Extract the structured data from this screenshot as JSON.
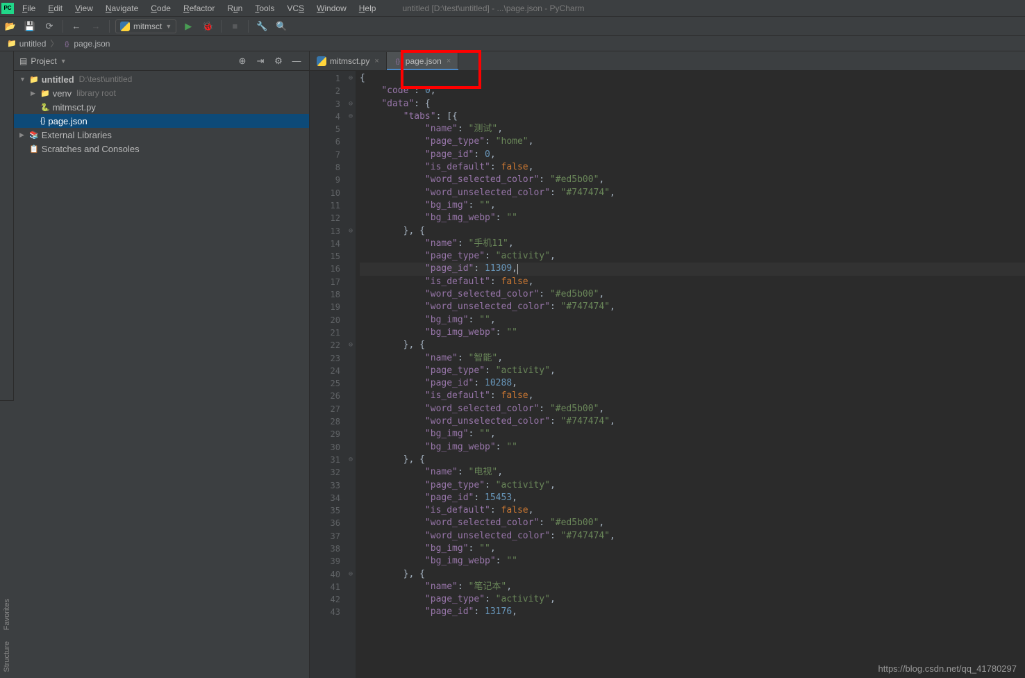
{
  "titlebar": {
    "title": "untitled [D:\\test\\untitled] - ...\\page.json - PyCharm"
  },
  "menu": [
    {
      "label": "File",
      "u": 0
    },
    {
      "label": "Edit",
      "u": 0
    },
    {
      "label": "View",
      "u": 0
    },
    {
      "label": "Navigate",
      "u": 0
    },
    {
      "label": "Code",
      "u": 0
    },
    {
      "label": "Refactor",
      "u": 0
    },
    {
      "label": "Run",
      "u": 1
    },
    {
      "label": "Tools",
      "u": 0
    },
    {
      "label": "VCS",
      "u": 2
    },
    {
      "label": "Window",
      "u": 0
    },
    {
      "label": "Help",
      "u": 0
    }
  ],
  "runconfig": {
    "name": "mitmsct"
  },
  "breadcrumbs": [
    {
      "icon": "folder",
      "text": "untitled"
    },
    {
      "icon": "json",
      "text": "page.json"
    }
  ],
  "panel": {
    "title": "Project"
  },
  "tree": [
    {
      "indent": 0,
      "arrow": "▼",
      "icon": "folder",
      "label": "untitled",
      "hint": "D:\\test\\untitled",
      "bold": true
    },
    {
      "indent": 1,
      "arrow": "▶",
      "icon": "folder",
      "label": "venv",
      "hint": "library root"
    },
    {
      "indent": 1,
      "arrow": "",
      "icon": "py",
      "label": "mitmsct.py"
    },
    {
      "indent": 1,
      "arrow": "",
      "icon": "json",
      "label": "page.json",
      "selected": true
    },
    {
      "indent": 0,
      "arrow": "▶",
      "icon": "lib",
      "label": "External Libraries"
    },
    {
      "indent": 0,
      "arrow": "",
      "icon": "scratch",
      "label": "Scratches and Consoles"
    }
  ],
  "tabs": [
    {
      "icon": "py",
      "label": "mitmsct.py",
      "active": false
    },
    {
      "icon": "json",
      "label": "page.json",
      "active": true
    }
  ],
  "code": [
    [
      {
        "t": "{",
        "c": "p"
      }
    ],
    [
      {
        "t": "    ",
        "c": "p"
      },
      {
        "t": "\"code\"",
        "c": "k"
      },
      {
        "t": ": ",
        "c": "p"
      },
      {
        "t": "0",
        "c": "n"
      },
      {
        "t": ",",
        "c": "p"
      }
    ],
    [
      {
        "t": "    ",
        "c": "p"
      },
      {
        "t": "\"data\"",
        "c": "k"
      },
      {
        "t": ": {",
        "c": "p"
      }
    ],
    [
      {
        "t": "        ",
        "c": "p"
      },
      {
        "t": "\"tabs\"",
        "c": "k"
      },
      {
        "t": ": [{",
        "c": "p"
      }
    ],
    [
      {
        "t": "            ",
        "c": "p"
      },
      {
        "t": "\"name\"",
        "c": "k"
      },
      {
        "t": ": ",
        "c": "p"
      },
      {
        "t": "\"测试\"",
        "c": "s"
      },
      {
        "t": ",",
        "c": "p"
      }
    ],
    [
      {
        "t": "            ",
        "c": "p"
      },
      {
        "t": "\"page_type\"",
        "c": "k"
      },
      {
        "t": ": ",
        "c": "p"
      },
      {
        "t": "\"home\"",
        "c": "s"
      },
      {
        "t": ",",
        "c": "p"
      }
    ],
    [
      {
        "t": "            ",
        "c": "p"
      },
      {
        "t": "\"page_id\"",
        "c": "k"
      },
      {
        "t": ": ",
        "c": "p"
      },
      {
        "t": "0",
        "c": "n"
      },
      {
        "t": ",",
        "c": "p"
      }
    ],
    [
      {
        "t": "            ",
        "c": "p"
      },
      {
        "t": "\"is_default\"",
        "c": "k"
      },
      {
        "t": ": ",
        "c": "p"
      },
      {
        "t": "false",
        "c": "b"
      },
      {
        "t": ",",
        "c": "p"
      }
    ],
    [
      {
        "t": "            ",
        "c": "p"
      },
      {
        "t": "\"word_selected_color\"",
        "c": "k"
      },
      {
        "t": ": ",
        "c": "p"
      },
      {
        "t": "\"#ed5b00\"",
        "c": "s"
      },
      {
        "t": ",",
        "c": "p"
      }
    ],
    [
      {
        "t": "            ",
        "c": "p"
      },
      {
        "t": "\"word_unselected_color\"",
        "c": "k"
      },
      {
        "t": ": ",
        "c": "p"
      },
      {
        "t": "\"#747474\"",
        "c": "s"
      },
      {
        "t": ",",
        "c": "p"
      }
    ],
    [
      {
        "t": "            ",
        "c": "p"
      },
      {
        "t": "\"bg_img\"",
        "c": "k"
      },
      {
        "t": ": ",
        "c": "p"
      },
      {
        "t": "\"\"",
        "c": "s"
      },
      {
        "t": ",",
        "c": "p"
      }
    ],
    [
      {
        "t": "            ",
        "c": "p"
      },
      {
        "t": "\"bg_img_webp\"",
        "c": "k"
      },
      {
        "t": ": ",
        "c": "p"
      },
      {
        "t": "\"\"",
        "c": "s"
      }
    ],
    [
      {
        "t": "        }, {",
        "c": "p"
      }
    ],
    [
      {
        "t": "            ",
        "c": "p"
      },
      {
        "t": "\"name\"",
        "c": "k"
      },
      {
        "t": ": ",
        "c": "p"
      },
      {
        "t": "\"手机11\"",
        "c": "s"
      },
      {
        "t": ",",
        "c": "p"
      }
    ],
    [
      {
        "t": "            ",
        "c": "p"
      },
      {
        "t": "\"page_type\"",
        "c": "k"
      },
      {
        "t": ": ",
        "c": "p"
      },
      {
        "t": "\"activity\"",
        "c": "s"
      },
      {
        "t": ",",
        "c": "p"
      }
    ],
    [
      {
        "t": "            ",
        "c": "p"
      },
      {
        "t": "\"page_id\"",
        "c": "k"
      },
      {
        "t": ": ",
        "c": "p"
      },
      {
        "t": "11309",
        "c": "n"
      },
      {
        "t": ",",
        "c": "p"
      },
      {
        "t": "CARET",
        "c": "caret"
      }
    ],
    [
      {
        "t": "            ",
        "c": "p"
      },
      {
        "t": "\"is_default\"",
        "c": "k"
      },
      {
        "t": ": ",
        "c": "p"
      },
      {
        "t": "false",
        "c": "b"
      },
      {
        "t": ",",
        "c": "p"
      }
    ],
    [
      {
        "t": "            ",
        "c": "p"
      },
      {
        "t": "\"word_selected_color\"",
        "c": "k"
      },
      {
        "t": ": ",
        "c": "p"
      },
      {
        "t": "\"#ed5b00\"",
        "c": "s"
      },
      {
        "t": ",",
        "c": "p"
      }
    ],
    [
      {
        "t": "            ",
        "c": "p"
      },
      {
        "t": "\"word_unselected_color\"",
        "c": "k"
      },
      {
        "t": ": ",
        "c": "p"
      },
      {
        "t": "\"#747474\"",
        "c": "s"
      },
      {
        "t": ",",
        "c": "p"
      }
    ],
    [
      {
        "t": "            ",
        "c": "p"
      },
      {
        "t": "\"bg_img\"",
        "c": "k"
      },
      {
        "t": ": ",
        "c": "p"
      },
      {
        "t": "\"\"",
        "c": "s"
      },
      {
        "t": ",",
        "c": "p"
      }
    ],
    [
      {
        "t": "            ",
        "c": "p"
      },
      {
        "t": "\"bg_img_webp\"",
        "c": "k"
      },
      {
        "t": ": ",
        "c": "p"
      },
      {
        "t": "\"\"",
        "c": "s"
      }
    ],
    [
      {
        "t": "        }, {",
        "c": "p"
      }
    ],
    [
      {
        "t": "            ",
        "c": "p"
      },
      {
        "t": "\"name\"",
        "c": "k"
      },
      {
        "t": ": ",
        "c": "p"
      },
      {
        "t": "\"智能\"",
        "c": "s"
      },
      {
        "t": ",",
        "c": "p"
      }
    ],
    [
      {
        "t": "            ",
        "c": "p"
      },
      {
        "t": "\"page_type\"",
        "c": "k"
      },
      {
        "t": ": ",
        "c": "p"
      },
      {
        "t": "\"activity\"",
        "c": "s"
      },
      {
        "t": ",",
        "c": "p"
      }
    ],
    [
      {
        "t": "            ",
        "c": "p"
      },
      {
        "t": "\"page_id\"",
        "c": "k"
      },
      {
        "t": ": ",
        "c": "p"
      },
      {
        "t": "10288",
        "c": "n"
      },
      {
        "t": ",",
        "c": "p"
      }
    ],
    [
      {
        "t": "            ",
        "c": "p"
      },
      {
        "t": "\"is_default\"",
        "c": "k"
      },
      {
        "t": ": ",
        "c": "p"
      },
      {
        "t": "false",
        "c": "b"
      },
      {
        "t": ",",
        "c": "p"
      }
    ],
    [
      {
        "t": "            ",
        "c": "p"
      },
      {
        "t": "\"word_selected_color\"",
        "c": "k"
      },
      {
        "t": ": ",
        "c": "p"
      },
      {
        "t": "\"#ed5b00\"",
        "c": "s"
      },
      {
        "t": ",",
        "c": "p"
      }
    ],
    [
      {
        "t": "            ",
        "c": "p"
      },
      {
        "t": "\"word_unselected_color\"",
        "c": "k"
      },
      {
        "t": ": ",
        "c": "p"
      },
      {
        "t": "\"#747474\"",
        "c": "s"
      },
      {
        "t": ",",
        "c": "p"
      }
    ],
    [
      {
        "t": "            ",
        "c": "p"
      },
      {
        "t": "\"bg_img\"",
        "c": "k"
      },
      {
        "t": ": ",
        "c": "p"
      },
      {
        "t": "\"\"",
        "c": "s"
      },
      {
        "t": ",",
        "c": "p"
      }
    ],
    [
      {
        "t": "            ",
        "c": "p"
      },
      {
        "t": "\"bg_img_webp\"",
        "c": "k"
      },
      {
        "t": ": ",
        "c": "p"
      },
      {
        "t": "\"\"",
        "c": "s"
      }
    ],
    [
      {
        "t": "        }, {",
        "c": "p"
      }
    ],
    [
      {
        "t": "            ",
        "c": "p"
      },
      {
        "t": "\"name\"",
        "c": "k"
      },
      {
        "t": ": ",
        "c": "p"
      },
      {
        "t": "\"电视\"",
        "c": "s"
      },
      {
        "t": ",",
        "c": "p"
      }
    ],
    [
      {
        "t": "            ",
        "c": "p"
      },
      {
        "t": "\"page_type\"",
        "c": "k"
      },
      {
        "t": ": ",
        "c": "p"
      },
      {
        "t": "\"activity\"",
        "c": "s"
      },
      {
        "t": ",",
        "c": "p"
      }
    ],
    [
      {
        "t": "            ",
        "c": "p"
      },
      {
        "t": "\"page_id\"",
        "c": "k"
      },
      {
        "t": ": ",
        "c": "p"
      },
      {
        "t": "15453",
        "c": "n"
      },
      {
        "t": ",",
        "c": "p"
      }
    ],
    [
      {
        "t": "            ",
        "c": "p"
      },
      {
        "t": "\"is_default\"",
        "c": "k"
      },
      {
        "t": ": ",
        "c": "p"
      },
      {
        "t": "false",
        "c": "b"
      },
      {
        "t": ",",
        "c": "p"
      }
    ],
    [
      {
        "t": "            ",
        "c": "p"
      },
      {
        "t": "\"word_selected_color\"",
        "c": "k"
      },
      {
        "t": ": ",
        "c": "p"
      },
      {
        "t": "\"#ed5b00\"",
        "c": "s"
      },
      {
        "t": ",",
        "c": "p"
      }
    ],
    [
      {
        "t": "            ",
        "c": "p"
      },
      {
        "t": "\"word_unselected_color\"",
        "c": "k"
      },
      {
        "t": ": ",
        "c": "p"
      },
      {
        "t": "\"#747474\"",
        "c": "s"
      },
      {
        "t": ",",
        "c": "p"
      }
    ],
    [
      {
        "t": "            ",
        "c": "p"
      },
      {
        "t": "\"bg_img\"",
        "c": "k"
      },
      {
        "t": ": ",
        "c": "p"
      },
      {
        "t": "\"\"",
        "c": "s"
      },
      {
        "t": ",",
        "c": "p"
      }
    ],
    [
      {
        "t": "            ",
        "c": "p"
      },
      {
        "t": "\"bg_img_webp\"",
        "c": "k"
      },
      {
        "t": ": ",
        "c": "p"
      },
      {
        "t": "\"\"",
        "c": "s"
      }
    ],
    [
      {
        "t": "        }, {",
        "c": "p"
      }
    ],
    [
      {
        "t": "            ",
        "c": "p"
      },
      {
        "t": "\"name\"",
        "c": "k"
      },
      {
        "t": ": ",
        "c": "p"
      },
      {
        "t": "\"笔记本\"",
        "c": "s"
      },
      {
        "t": ",",
        "c": "p"
      }
    ],
    [
      {
        "t": "            ",
        "c": "p"
      },
      {
        "t": "\"page_type\"",
        "c": "k"
      },
      {
        "t": ": ",
        "c": "p"
      },
      {
        "t": "\"activity\"",
        "c": "s"
      },
      {
        "t": ",",
        "c": "p"
      }
    ],
    [
      {
        "t": "            ",
        "c": "p"
      },
      {
        "t": "\"page_id\"",
        "c": "k"
      },
      {
        "t": ": ",
        "c": "p"
      },
      {
        "t": "13176",
        "c": "n"
      },
      {
        "t": ",",
        "c": "p"
      }
    ]
  ],
  "fold": {
    "1": "⊖",
    "2": "",
    "3": "⊖",
    "4": "⊖",
    "13": "⊖",
    "22": "⊖",
    "31": "⊖",
    "40": "⊖"
  },
  "cursor_line": 16,
  "sidebar_tabs": [
    "Favorites",
    "Structure"
  ],
  "watermark": "https://blog.csdn.net/qq_41780297"
}
